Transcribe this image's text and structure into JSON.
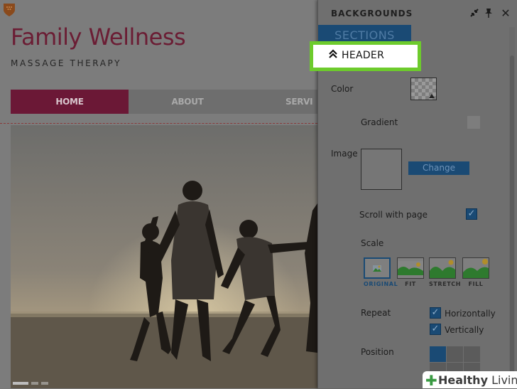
{
  "site": {
    "title": "Family Wellness",
    "subtitle": "MASSAGE THERAPY",
    "nav": [
      {
        "label": "HOME"
      },
      {
        "label": "ABOUT"
      },
      {
        "label": "SERVI"
      }
    ],
    "colors": {
      "brand": "#6b1836"
    }
  },
  "panel": {
    "title": "BACKGROUNDS",
    "icons": [
      "collapse-icon",
      "pin-icon",
      "close-icon"
    ],
    "sections_tab": "SECTIONS",
    "header_button": {
      "icon": "double-chevron-up-icon",
      "label": "HEADER"
    },
    "fields": {
      "color_label": "Color",
      "gradient_label": "Gradient",
      "image_label": "Image",
      "change_label": "Change",
      "scroll_label": "Scroll with page",
      "scroll_checked": true,
      "scale_label": "Scale",
      "scale_options": [
        {
          "label": "ORIGINAL",
          "selected": true
        },
        {
          "label": "FIT",
          "selected": false
        },
        {
          "label": "STRETCH",
          "selected": false
        },
        {
          "label": "FILL",
          "selected": false
        }
      ],
      "repeat_label": "Repeat",
      "repeat_horizontally": "Horizontally",
      "repeat_vertically": "Vertically",
      "horizontally_checked": true,
      "vertically_checked": true,
      "position_label": "Position"
    },
    "colors": {
      "accent": "#1a4a74",
      "highlight": "#6dcb2c"
    }
  },
  "watermark": {
    "part1": "Healthy",
    "part2": "Living"
  }
}
